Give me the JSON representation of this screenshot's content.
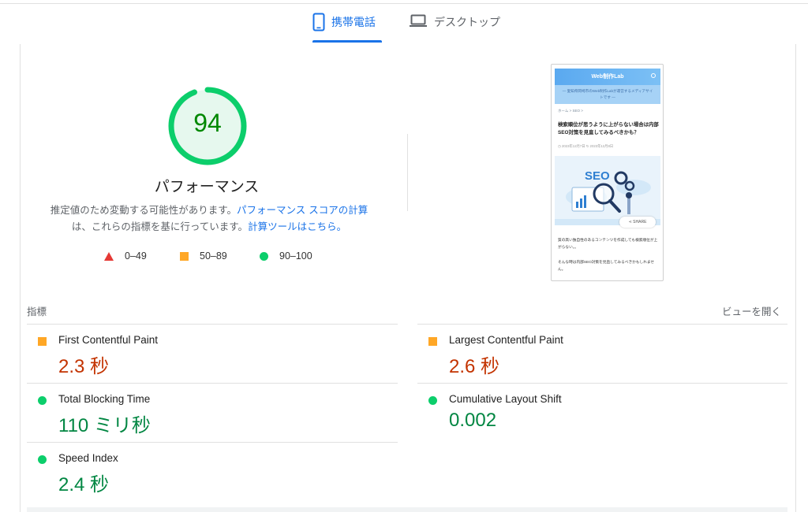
{
  "tabs": {
    "mobile_label": "携帯電話",
    "desktop_label": "デスクトップ",
    "active": "mobile"
  },
  "score": {
    "value": "94",
    "fraction": 0.94,
    "color": "#0cce6b",
    "title": "パフォーマンス"
  },
  "description": {
    "text1": "推定値のため変動する可能性があります。",
    "link1": "パフォーマンス スコアの計算",
    "text2": "は、これらの指標を基に行っています。",
    "link2": "計算ツールはこちら。"
  },
  "legend": [
    {
      "range": "0–49",
      "icon": "red-triangle"
    },
    {
      "range": "50–89",
      "icon": "orange-square"
    },
    {
      "range": "90–100",
      "icon": "green-circle"
    }
  ],
  "thumbnail": {
    "site_title": "Web制作Lab",
    "tagline_line1": "— 愛知県岡崎市のWeb制作Labが運営するメディアサイ",
    "tagline_line2": "トです —",
    "breadcrumb": "ホーム > SEO >",
    "article_title": "検索順位が思うように上がらない場合は内部SEO対策を見直してみるべきかも？",
    "dates": "◷ 2023年12月7日  ↻ 2023年12月8日",
    "hero_text": "SEO",
    "share_label": "SHARE",
    "body1": "質の高い独自性のあるコンテンツを作成しても検索順位が上がらない。。",
    "body2": "そんな時は内部SEO対策を見直してみるべきかもしれません。"
  },
  "metrics": {
    "section_label": "指標",
    "expand_label": "ビューを開く",
    "items": [
      {
        "name": "First Contentful Paint",
        "value": "2.3 秒",
        "status": "average"
      },
      {
        "name": "Largest Contentful Paint",
        "value": "2.6 秒",
        "status": "average"
      },
      {
        "name": "Total Blocking Time",
        "value": "110 ミリ秒",
        "status": "good"
      },
      {
        "name": "Cumulative Layout Shift",
        "value": "0.002",
        "status": "good"
      },
      {
        "name": "Speed Index",
        "value": "2.4 秒",
        "status": "good"
      }
    ]
  },
  "colors": {
    "accent": "#1a73e8",
    "good": "#0cce6b",
    "average": "#ffa726",
    "poor": "#e53935"
  }
}
